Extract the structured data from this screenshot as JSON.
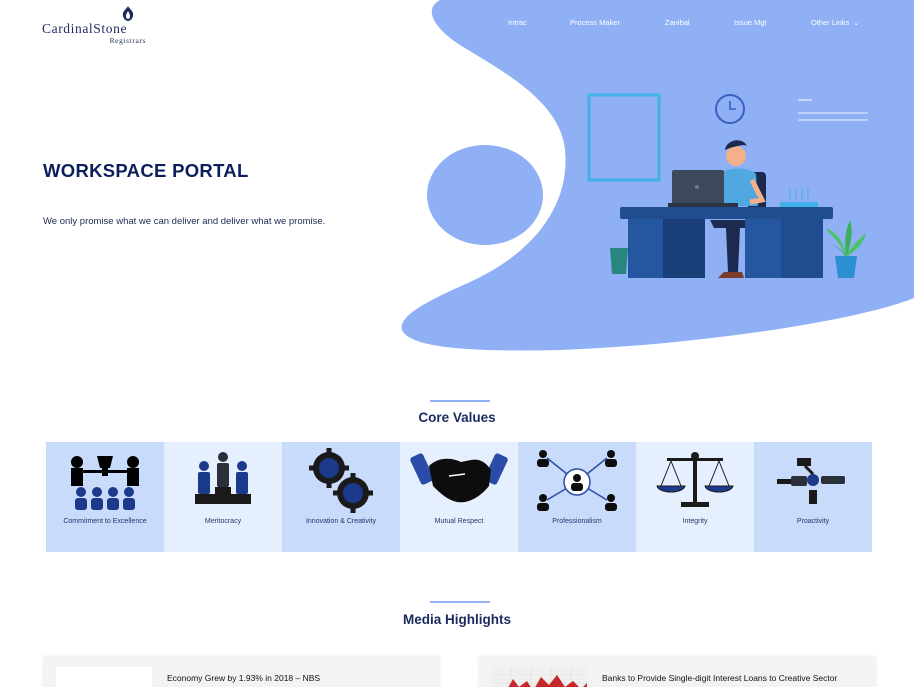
{
  "brand": {
    "name": "CardinalStone",
    "subtitle": "Registrars",
    "navy": "#1b2a5e",
    "accent": "#8fb0f5"
  },
  "nav": {
    "items": [
      {
        "label": "Intrac"
      },
      {
        "label": "Process Maker"
      },
      {
        "label": "Zanibal"
      },
      {
        "label": "Issue Mgt"
      },
      {
        "label": "Other Links",
        "icon": "chevron-down-icon"
      }
    ]
  },
  "hero": {
    "title": "WORKSPACE PORTAL",
    "tagline": "We only promise what we can deliver and deliver what we promise."
  },
  "core_values": {
    "heading": "Core Values",
    "items": [
      {
        "label": "Commitment to Excellence",
        "icon": "award-team-icon"
      },
      {
        "label": "Meritocracy",
        "icon": "podium-icon"
      },
      {
        "label": "Innovation & Creativity",
        "icon": "gears-icon"
      },
      {
        "label": "Mutual Respect",
        "icon": "handshake-icon"
      },
      {
        "label": "Professionalism",
        "icon": "network-people-icon"
      },
      {
        "label": "Integrity",
        "icon": "scales-icon"
      },
      {
        "label": "Proactivity",
        "icon": "proactivity-icon"
      }
    ]
  },
  "media": {
    "heading": "Media Highlights",
    "articles": [
      {
        "title": "Economy Grew by 1.93% in 2018 – NBS"
      },
      {
        "title": "Banks to Provide Single-digit Interest Loans to Creative Sector"
      }
    ]
  }
}
